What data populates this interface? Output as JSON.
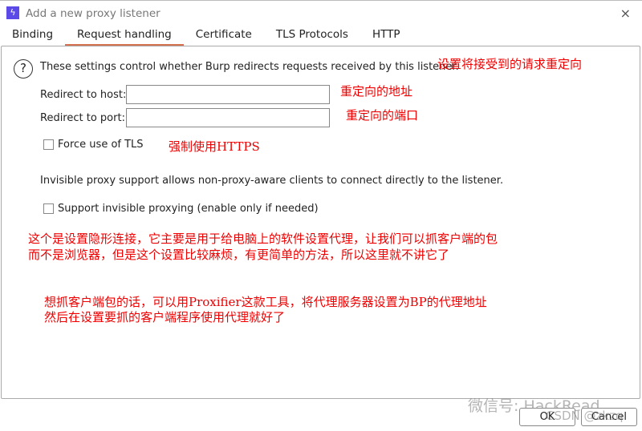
{
  "window": {
    "title": "Add a new proxy listener",
    "icon": "burp-lightning-icon",
    "close": "×"
  },
  "tabs": [
    {
      "label": "Binding"
    },
    {
      "label": "Request handling"
    },
    {
      "label": "Certificate"
    },
    {
      "label": "TLS Protocols"
    },
    {
      "label": "HTTP"
    }
  ],
  "panel": {
    "help_text": "These settings control whether Burp redirects requests received by this listener.",
    "redirect_host_label": "Redirect to host:",
    "redirect_host_value": "",
    "redirect_port_label": "Redirect to port:",
    "redirect_port_value": "",
    "force_tls_label": "Force use of TLS",
    "invisible_text": "Invisible proxy support allows non-proxy-aware clients to connect directly to the listener.",
    "invisible_label": "Support invisible proxying (enable only if needed)"
  },
  "annotations": {
    "a1": "设置将接受到的请求重定向",
    "a2": "重定向的地址",
    "a3": "重定向的端口",
    "a4": "强制使用HTTPS",
    "a5": "这个是设置隐形连接，它主要是用于给电脑上的软件设置代理，让我们可以抓客户端的包",
    "a6": "而不是浏览器，但是这个设置比较麻烦，有更简单的方法，所以这里就不讲它了",
    "a7": "想抓客户端包的话，可以用Proxifier这款工具，将代理服务器设置为BP的代理地址",
    "a8": "然后在设置要抓的客户端程序使用代理就好了"
  },
  "buttons": {
    "ok": "OK",
    "cancel": "Cancel"
  },
  "watermarks": {
    "wechat": "微信号: HackRead",
    "csdn": "CSDN @zkzq"
  },
  "colors": {
    "accent": "#d4724f",
    "annotation": "#e00000",
    "icon": "#5b4ae8"
  }
}
